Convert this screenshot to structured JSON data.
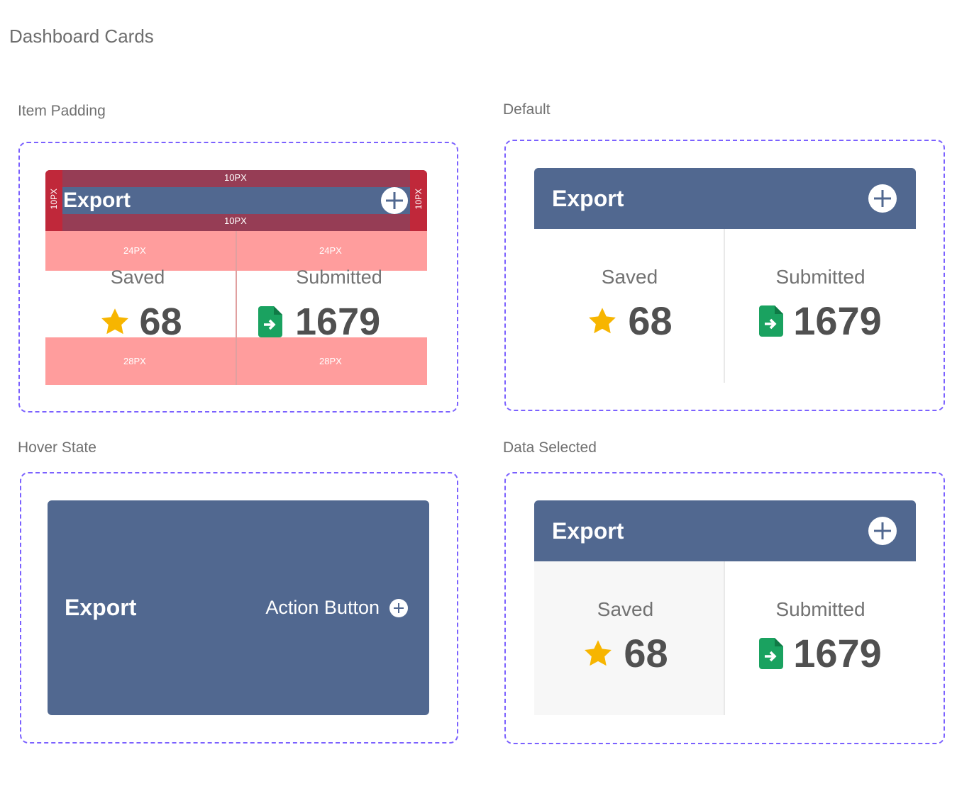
{
  "page_title": "Dashboard Cards",
  "sections": {
    "item_padding": "Item Padding",
    "default": "Default",
    "hover_state": "Hover State",
    "data_selected": "Data Selected"
  },
  "card": {
    "title": "Export",
    "saved_label": "Saved",
    "saved_value": "68",
    "submitted_label": "Submitted",
    "submitted_value": "1679",
    "action_button": "Action Button"
  },
  "padding_annotations": {
    "top": "10PX",
    "bottom": "10PX",
    "left": "10PX",
    "right": "10PX",
    "label_pad_left": "24PX",
    "label_pad_right": "24PX",
    "value_pad_left": "28PX",
    "value_pad_right": "28PX"
  },
  "icons": {
    "saved": "star-icon",
    "submitted": "document-export-icon",
    "add": "plus-circle-icon"
  },
  "colors": {
    "header": "#516890",
    "frame": "#7b61ff",
    "star": "#f7b500",
    "doc": "#1aa260",
    "padding_header": "#963d55",
    "padding_side": "#c0283a",
    "padding_body": "#ff9d9d"
  }
}
